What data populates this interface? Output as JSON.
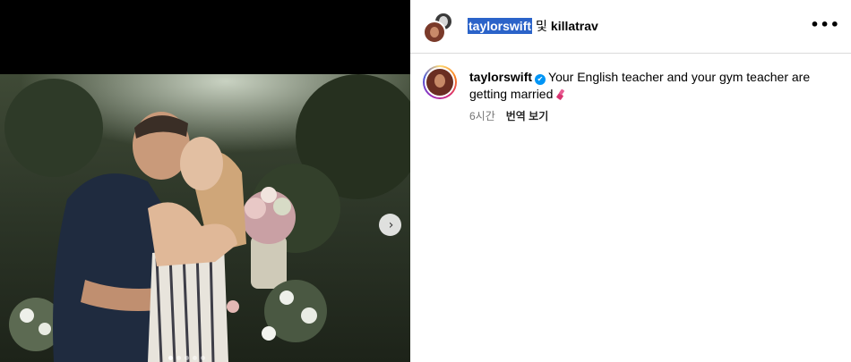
{
  "header": {
    "username": "taylorswift",
    "conjunction": "및",
    "collaborator": "killatrav",
    "more_label": "•••"
  },
  "caption": {
    "username": "taylorswift",
    "verified_icon": "✔",
    "text": "Your English teacher and your gym teacher are getting married",
    "emoji": "lipstick-emoji",
    "time": "6시간",
    "translate_label": "번역 보기"
  },
  "media": {
    "next_label": "›",
    "carousel_count": 5,
    "carousel_index": 1
  },
  "colors": {
    "selection": "#2b63c9",
    "verified": "#0095f6",
    "meta": "#737373"
  }
}
